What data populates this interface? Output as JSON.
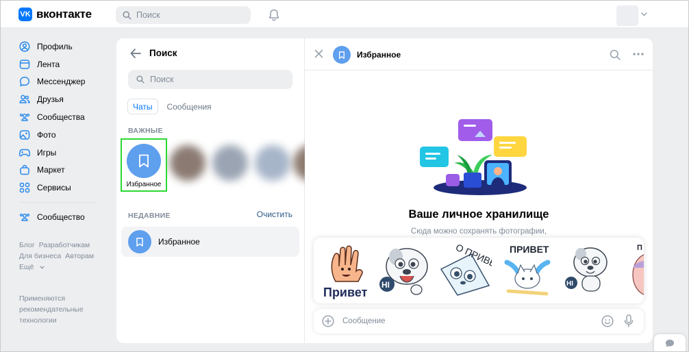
{
  "header": {
    "logo_text": "вконтакте",
    "logo_mark": "VK",
    "search_placeholder": "Поиск"
  },
  "nav": {
    "items": [
      {
        "label": "Профиль",
        "icon": "user-circle-icon"
      },
      {
        "label": "Лента",
        "icon": "news-icon"
      },
      {
        "label": "Мессенджер",
        "icon": "message-icon"
      },
      {
        "label": "Друзья",
        "icon": "friends-icon"
      },
      {
        "label": "Сообщества",
        "icon": "groups-icon"
      },
      {
        "label": "Фото",
        "icon": "photo-icon"
      },
      {
        "label": "Игры",
        "icon": "gamepad-icon"
      },
      {
        "label": "Маркет",
        "icon": "bag-icon"
      },
      {
        "label": "Сервисы",
        "icon": "grid-icon"
      }
    ],
    "community": "Сообщество"
  },
  "footer": {
    "blog": "Блог",
    "developers": "Разработчикам",
    "business": "Для бизнеса",
    "authors": "Авторам",
    "more": "Ещё",
    "note": "Применяются рекомендательные технологии"
  },
  "search_panel": {
    "title": "Поиск",
    "placeholder": "Поиск",
    "tab_chats": "Чаты",
    "tab_messages": "Сообщения",
    "important_label": "ВАЖНЫЕ",
    "favorites_label": "Избранное",
    "recent_label": "НЕДАВНИЕ",
    "clear_label": "Очистить",
    "recent_items": [
      {
        "name": "Избранное"
      }
    ]
  },
  "chat": {
    "title": "Избранное",
    "storage_title": "Ваше личное хранилище",
    "storage_sub": "Сюда можно сохранять фотографии,",
    "composer_placeholder": "Сообщение",
    "stickers": [
      {
        "caption": "Привет"
      },
      {
        "caption": "HI"
      },
      {
        "caption": "О ПРИВЕТ"
      },
      {
        "caption": "ПРИВЕТ"
      },
      {
        "caption": "HI"
      },
      {
        "caption": "П"
      }
    ]
  },
  "colors": {
    "accent": "#0077ff",
    "avatar_blue": "#5e9fee",
    "highlight": "#2bd932"
  }
}
